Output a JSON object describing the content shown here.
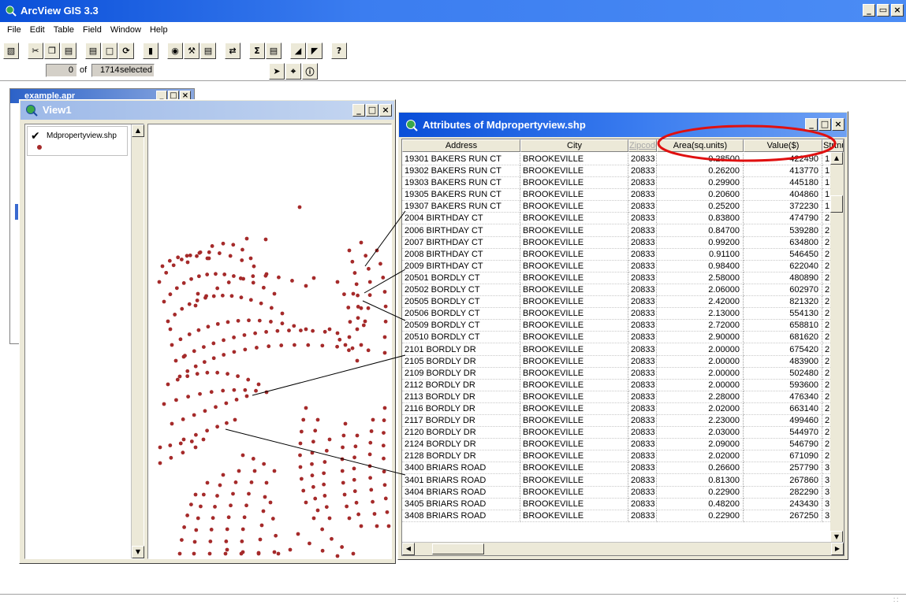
{
  "app": {
    "title": "ArcView GIS 3.3"
  },
  "menu": [
    "File",
    "Edit",
    "Table",
    "Field",
    "Window",
    "Help"
  ],
  "selection": {
    "selected_count": "0",
    "of_label": "of",
    "total_count": "1714",
    "suffix": "selected"
  },
  "project_window": {
    "title": "example.apr"
  },
  "view_window": {
    "title": "View1",
    "legend": {
      "theme_name": "Mdpropertyview.shp",
      "checked": true,
      "symbol_color": "#a52a2a"
    }
  },
  "attribute_window": {
    "title": "Attributes of Mdpropertyview.shp",
    "columns": [
      "Address",
      "City",
      "Zipcode",
      "Area(sq.units)",
      "Value($)",
      "Strtnu"
    ],
    "rows": [
      [
        "19301 BAKERS RUN CT",
        "BROOKEVILLE",
        "20833",
        "0.28500",
        "422490",
        "1"
      ],
      [
        "19302 BAKERS RUN CT",
        "BROOKEVILLE",
        "20833",
        "0.26200",
        "413770",
        "1"
      ],
      [
        "19303 BAKERS RUN CT",
        "BROOKEVILLE",
        "20833",
        "0.29900",
        "445180",
        "1"
      ],
      [
        "19305 BAKERS RUN CT",
        "BROOKEVILLE",
        "20833",
        "0.20600",
        "404860",
        "1"
      ],
      [
        "19307 BAKERS RUN CT",
        "BROOKEVILLE",
        "20833",
        "0.25200",
        "372230",
        "1"
      ],
      [
        "2004 BIRTHDAY CT",
        "BROOKEVILLE",
        "20833",
        "0.83800",
        "474790",
        "2"
      ],
      [
        "2006 BIRTHDAY CT",
        "BROOKEVILLE",
        "20833",
        "0.84700",
        "539280",
        "2"
      ],
      [
        "2007 BIRTHDAY CT",
        "BROOKEVILLE",
        "20833",
        "0.99200",
        "634800",
        "2"
      ],
      [
        "2008 BIRTHDAY CT",
        "BROOKEVILLE",
        "20833",
        "0.91100",
        "546450",
        "2"
      ],
      [
        "2009 BIRTHDAY CT",
        "BROOKEVILLE",
        "20833",
        "0.98400",
        "622040",
        "2"
      ],
      [
        "20501 BORDLY CT",
        "BROOKEVILLE",
        "20833",
        "2.58000",
        "480890",
        "2"
      ],
      [
        "20502 BORDLY CT",
        "BROOKEVILLE",
        "20833",
        "2.06000",
        "602970",
        "2"
      ],
      [
        "20505 BORDLY CT",
        "BROOKEVILLE",
        "20833",
        "2.42000",
        "821320",
        "2"
      ],
      [
        "20506 BORDLY CT",
        "BROOKEVILLE",
        "20833",
        "2.13000",
        "554130",
        "2"
      ],
      [
        "20509 BORDLY CT",
        "BROOKEVILLE",
        "20833",
        "2.72000",
        "658810",
        "2"
      ],
      [
        "20510 BORDLY CT",
        "BROOKEVILLE",
        "20833",
        "2.90000",
        "681620",
        "2"
      ],
      [
        "2101 BORDLY DR",
        "BROOKEVILLE",
        "20833",
        "2.00000",
        "675420",
        "2"
      ],
      [
        "2105 BORDLY DR",
        "BROOKEVILLE",
        "20833",
        "2.00000",
        "483900",
        "2"
      ],
      [
        "2109 BORDLY DR",
        "BROOKEVILLE",
        "20833",
        "2.00000",
        "502480",
        "2"
      ],
      [
        "2112 BORDLY DR",
        "BROOKEVILLE",
        "20833",
        "2.00000",
        "593600",
        "2"
      ],
      [
        "2113 BORDLY DR",
        "BROOKEVILLE",
        "20833",
        "2.28000",
        "476340",
        "2"
      ],
      [
        "2116 BORDLY DR",
        "BROOKEVILLE",
        "20833",
        "2.02000",
        "663140",
        "2"
      ],
      [
        "2117 BORDLY DR",
        "BROOKEVILLE",
        "20833",
        "2.23000",
        "499460",
        "2"
      ],
      [
        "2120 BORDLY DR",
        "BROOKEVILLE",
        "20833",
        "2.03000",
        "544970",
        "2"
      ],
      [
        "2124 BORDLY DR",
        "BROOKEVILLE",
        "20833",
        "2.09000",
        "546790",
        "2"
      ],
      [
        "2128 BORDLY DR",
        "BROOKEVILLE",
        "20833",
        "2.02000",
        "671090",
        "2"
      ],
      [
        "3400 BRIARS ROAD",
        "BROOKEVILLE",
        "20833",
        "0.26600",
        "257790",
        "3"
      ],
      [
        "3401 BRIARS ROAD",
        "BROOKEVILLE",
        "20833",
        "0.81300",
        "267860",
        "3"
      ],
      [
        "3404 BRIARS ROAD",
        "BROOKEVILLE",
        "20833",
        "0.22900",
        "282290",
        "3"
      ],
      [
        "3405 BRIARS ROAD",
        "BROOKEVILLE",
        "20833",
        "0.48200",
        "243430",
        "3"
      ],
      [
        "3408 BRIARS ROAD",
        "BROOKEVILLE",
        "20833",
        "0.22900",
        "267250",
        "3"
      ]
    ]
  },
  "colors": {
    "point_symbol": "#a52a2a",
    "annotation_ellipse": "#e01010",
    "title_active": "#0a4fd8",
    "title_inactive": "#9db9e8"
  }
}
